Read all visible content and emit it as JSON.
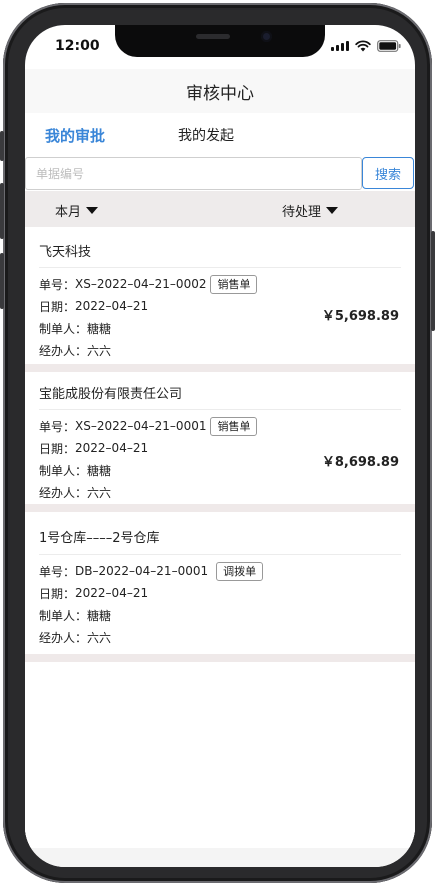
{
  "status_bar": {
    "time": "12:00",
    "signal_icon": "cellular-signal-icon",
    "wifi_icon": "wifi-icon",
    "battery_icon": "battery-icon"
  },
  "navbar": {
    "title": "审核中心"
  },
  "tabs": [
    {
      "label": "我的审批",
      "active": true
    },
    {
      "label": "我的发起",
      "active": false
    }
  ],
  "search": {
    "placeholder": "单据编号",
    "value": "",
    "button_label": "搜索"
  },
  "filters": {
    "period": "本月",
    "status": "待处理"
  },
  "colors": {
    "accent": "#3a86d8",
    "filter_bg": "#eeebeb",
    "separator": "#efe9e9"
  },
  "records": [
    {
      "title": "飞天科技",
      "number_label": "单号：",
      "number": "XS–2022–04–21–0002",
      "type": "销售单",
      "date_label": "日期：",
      "date": "2022–04–21",
      "maker_label": "制单人：",
      "maker": "糖糖",
      "handler_label": "经办人：",
      "handler": "六六",
      "amount": "￥5,698.89"
    },
    {
      "title": "宝能成股份有限责任公司",
      "number_label": "单号：",
      "number": "XS–2022–04–21–0001",
      "type": "销售单",
      "date_label": "日期：",
      "date": "2022–04–21",
      "maker_label": "制单人：",
      "maker": "糖糖",
      "handler_label": "经办人：",
      "handler": "六六",
      "amount": "￥8,698.89"
    },
    {
      "title": "1号仓库––––2号仓库",
      "number_label": "单号：",
      "number": "DB–2022–04–21–0001",
      "type": "调拨单",
      "date_label": "日期：",
      "date": "2022–04–21",
      "maker_label": "制单人：",
      "maker": "糖糖",
      "handler_label": "经办人：",
      "handler": "六六",
      "amount": ""
    }
  ]
}
